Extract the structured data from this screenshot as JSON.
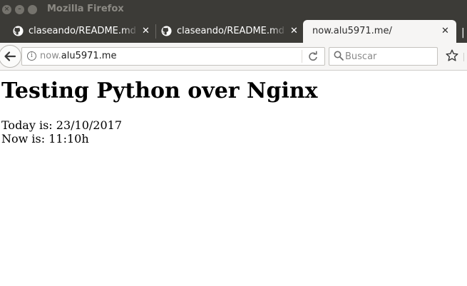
{
  "window": {
    "title": "Mozilla Firefox"
  },
  "tabs": [
    {
      "label": "claseando/README.md",
      "icon": "github-icon",
      "active": false
    },
    {
      "label": "claseando/README.md",
      "icon": "github-icon",
      "active": false
    },
    {
      "label": "now.alu5971.me/",
      "active": true
    }
  ],
  "navbar": {
    "url_prefix": "now.",
    "url_domain": "alu5971.me",
    "search_placeholder": "Buscar"
  },
  "page": {
    "heading": "Testing Python over Nginx",
    "today_line": "Today is: 23/10/2017",
    "now_line": "Now is: 11:10h"
  },
  "colors": {
    "titlebar": "#3c3b37",
    "toolbar": "#f6f5f4",
    "active_tab": "#f6f5f4"
  }
}
